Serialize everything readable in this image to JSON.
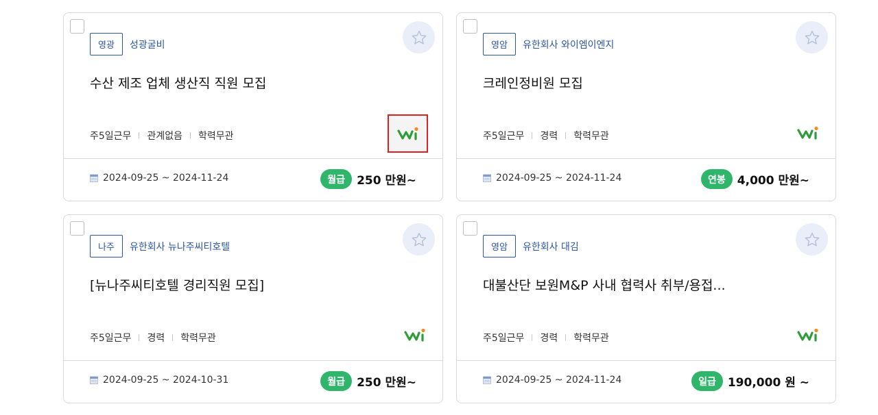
{
  "cards": [
    {
      "region": "영광",
      "company": "성광굴비",
      "title": "수산 제조 업체 생산직 직원 모집",
      "conditions": [
        "주5일근무",
        "관계없음",
        "학력무관"
      ],
      "date_range": "2024-09-25 ~ 2024-11-24",
      "pay_type": "월급",
      "pay_amount": "250 만원~",
      "logo_highlighted": true
    },
    {
      "region": "영암",
      "company": "유한회사 와이엠이엔지",
      "title": "크레인정비원 모집",
      "conditions": [
        "주5일근무",
        "경력",
        "학력무관"
      ],
      "date_range": "2024-09-25 ~ 2024-11-24",
      "pay_type": "연봉",
      "pay_amount": "4,000 만원~",
      "logo_highlighted": false
    },
    {
      "region": "나주",
      "company": "유한회사 뉴나주씨티호텔",
      "title": "[뉴나주씨티호텔 경리직원 모집]",
      "conditions": [
        "주5일근무",
        "경력",
        "학력무관"
      ],
      "date_range": "2024-09-25 ~ 2024-10-31",
      "pay_type": "월급",
      "pay_amount": "250 만원~",
      "logo_highlighted": false
    },
    {
      "region": "영암",
      "company": "유한회사 대김",
      "title": "대불산단 보원M&P 사내 협력사 취부/용접...",
      "conditions": [
        "주5일근무",
        "경력",
        "학력무관"
      ],
      "date_range": "2024-09-25 ~ 2024-11-24",
      "pay_type": "일급",
      "pay_amount": "190,000 원 ~",
      "logo_highlighted": false
    }
  ],
  "colors": {
    "accent_blue": "#2a55a3",
    "pay_green": "#2fb66a",
    "star_bg": "#e9eef9",
    "highlight_border": "#e02020"
  },
  "icons": [
    "star-icon",
    "calendar-icon",
    "worknet-logo-icon"
  ]
}
